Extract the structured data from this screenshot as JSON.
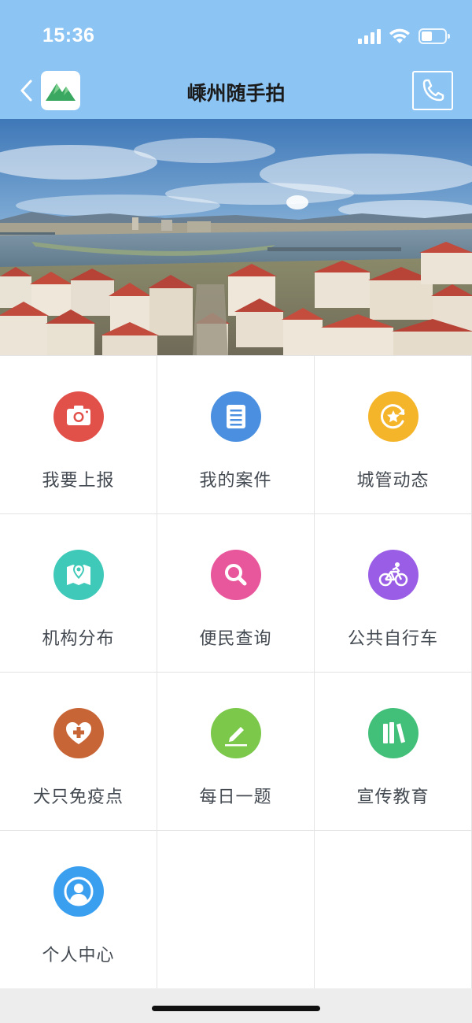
{
  "status_bar": {
    "time": "15:36",
    "battery_level": 0.45,
    "icons": [
      "signal-icon",
      "wifi-icon",
      "battery-icon"
    ]
  },
  "nav": {
    "title": "嵊州随手拍",
    "back_icon": "chevron-left-icon",
    "logo_icon": "mountain-logo-icon",
    "phone_icon": "phone-icon"
  },
  "banner": {
    "image": "city-river-panorama"
  },
  "grid": {
    "items": [
      {
        "label": "我要上报",
        "icon": "camera-icon",
        "color": "#e2504a"
      },
      {
        "label": "我的案件",
        "icon": "document-list-icon",
        "color": "#4a8fe0"
      },
      {
        "label": "城管动态",
        "icon": "star-refresh-icon",
        "color": "#f5b52a"
      },
      {
        "label": "机构分布",
        "icon": "map-pin-icon",
        "color": "#3ec9b8"
      },
      {
        "label": "便民查询",
        "icon": "search-icon",
        "color": "#e8569c"
      },
      {
        "label": "公共自行车",
        "icon": "bicycle-icon",
        "color": "#9a5ee6"
      },
      {
        "label": "犬只免疫点",
        "icon": "heart-cross-icon",
        "color": "#c76537"
      },
      {
        "label": "每日一题",
        "icon": "pen-icon",
        "color": "#7cc84a"
      },
      {
        "label": "宣传教育",
        "icon": "books-icon",
        "color": "#42c07a"
      },
      {
        "label": "个人中心",
        "icon": "user-icon",
        "color": "#3b9ff0"
      }
    ]
  }
}
